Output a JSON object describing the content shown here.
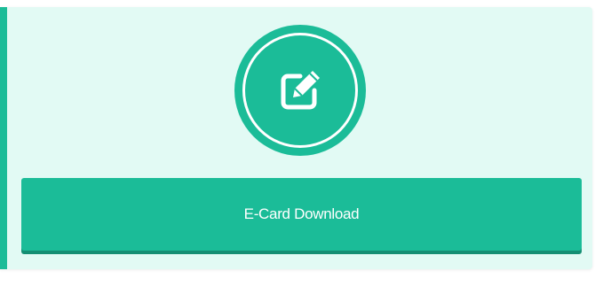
{
  "card": {
    "icon": "edit-icon",
    "button_label": "E-Card Download"
  },
  "colors": {
    "accent": "#1bbc98",
    "card_background": "#e2faf4",
    "button_shadow": "#158e73",
    "text_on_accent": "#ffffff"
  }
}
